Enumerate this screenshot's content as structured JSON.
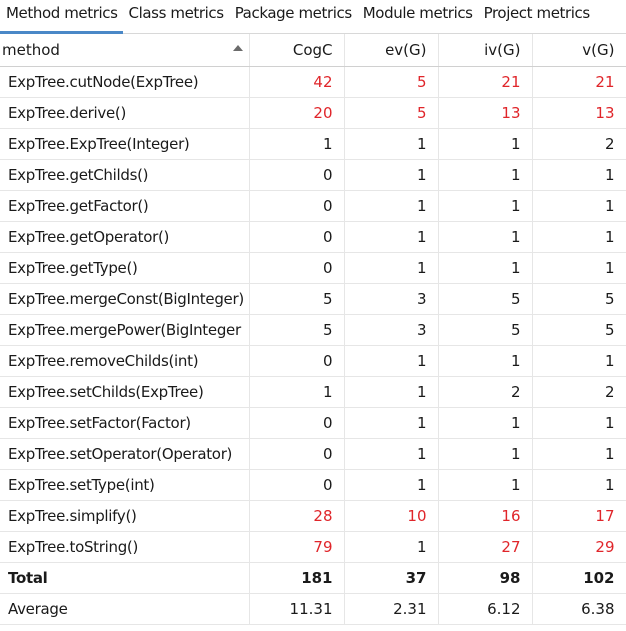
{
  "tabs": [
    {
      "label": "Method metrics",
      "active": true
    },
    {
      "label": "Class metrics",
      "active": false
    },
    {
      "label": "Package metrics",
      "active": false
    },
    {
      "label": "Module metrics",
      "active": false
    },
    {
      "label": "Project metrics",
      "active": false
    }
  ],
  "table": {
    "columns": [
      "method",
      "CogC",
      "ev(G)",
      "iv(G)",
      "v(G)"
    ],
    "sort": {
      "column": "method",
      "direction": "ascending",
      "icon": "sort-ascending-icon"
    },
    "highlight_color": "#e0252a",
    "rows": [
      {
        "method": "ExpTree.cutNode(ExpTree)",
        "values": [
          "42",
          "5",
          "21",
          "21"
        ],
        "red": [
          true,
          true,
          true,
          true
        ]
      },
      {
        "method": "ExpTree.derive()",
        "values": [
          "20",
          "5",
          "13",
          "13"
        ],
        "red": [
          true,
          true,
          true,
          true
        ]
      },
      {
        "method": "ExpTree.ExpTree(Integer)",
        "values": [
          "1",
          "1",
          "1",
          "2"
        ],
        "red": [
          false,
          false,
          false,
          false
        ]
      },
      {
        "method": "ExpTree.getChilds()",
        "values": [
          "0",
          "1",
          "1",
          "1"
        ],
        "red": [
          false,
          false,
          false,
          false
        ]
      },
      {
        "method": "ExpTree.getFactor()",
        "values": [
          "0",
          "1",
          "1",
          "1"
        ],
        "red": [
          false,
          false,
          false,
          false
        ]
      },
      {
        "method": "ExpTree.getOperator()",
        "values": [
          "0",
          "1",
          "1",
          "1"
        ],
        "red": [
          false,
          false,
          false,
          false
        ]
      },
      {
        "method": "ExpTree.getType()",
        "values": [
          "0",
          "1",
          "1",
          "1"
        ],
        "red": [
          false,
          false,
          false,
          false
        ]
      },
      {
        "method": "ExpTree.mergeConst(BigInteger)",
        "values": [
          "5",
          "3",
          "5",
          "5"
        ],
        "red": [
          false,
          false,
          false,
          false
        ]
      },
      {
        "method": "ExpTree.mergePower(BigInteger",
        "values": [
          "5",
          "3",
          "5",
          "5"
        ],
        "red": [
          false,
          false,
          false,
          false
        ]
      },
      {
        "method": "ExpTree.removeChilds(int)",
        "values": [
          "0",
          "1",
          "1",
          "1"
        ],
        "red": [
          false,
          false,
          false,
          false
        ]
      },
      {
        "method": "ExpTree.setChilds(ExpTree)",
        "values": [
          "1",
          "1",
          "2",
          "2"
        ],
        "red": [
          false,
          false,
          false,
          false
        ]
      },
      {
        "method": "ExpTree.setFactor(Factor)",
        "values": [
          "0",
          "1",
          "1",
          "1"
        ],
        "red": [
          false,
          false,
          false,
          false
        ]
      },
      {
        "method": "ExpTree.setOperator(Operator)",
        "values": [
          "0",
          "1",
          "1",
          "1"
        ],
        "red": [
          false,
          false,
          false,
          false
        ]
      },
      {
        "method": "ExpTree.setType(int)",
        "values": [
          "0",
          "1",
          "1",
          "1"
        ],
        "red": [
          false,
          false,
          false,
          false
        ]
      },
      {
        "method": "ExpTree.simplify()",
        "values": [
          "28",
          "10",
          "16",
          "17"
        ],
        "red": [
          true,
          true,
          true,
          true
        ]
      },
      {
        "method": "ExpTree.toString()",
        "values": [
          "79",
          "1",
          "27",
          "29"
        ],
        "red": [
          true,
          false,
          true,
          true
        ]
      }
    ],
    "total": {
      "label": "Total",
      "values": [
        "181",
        "37",
        "98",
        "102"
      ]
    },
    "average": {
      "label": "Average",
      "values": [
        "11.31",
        "2.31",
        "6.12",
        "6.38"
      ]
    }
  }
}
